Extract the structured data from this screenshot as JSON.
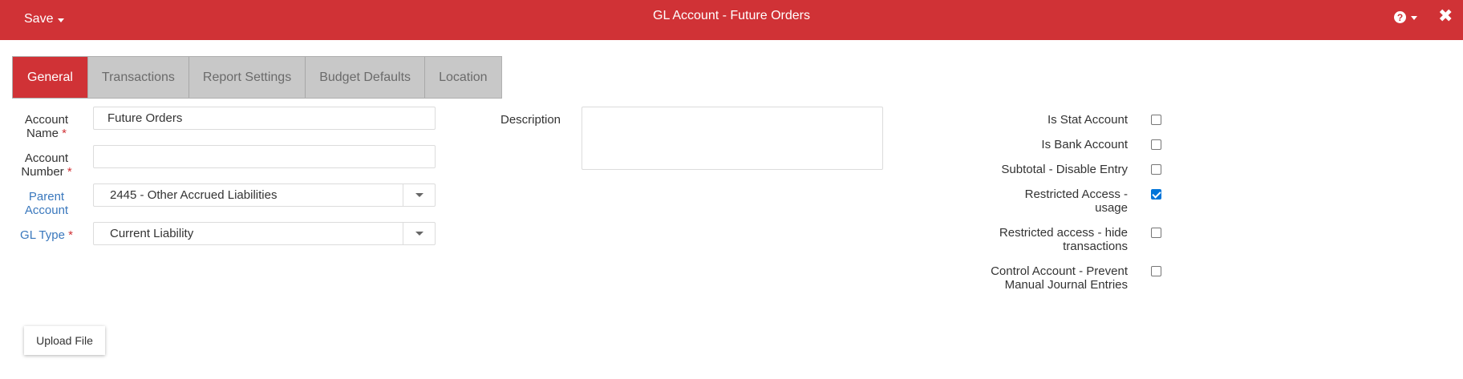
{
  "header": {
    "save_label": "Save",
    "title": "GL Account - Future Orders",
    "help_icon": "question-circle-icon",
    "close_icon": "close-icon",
    "close_glyph": "✖",
    "help_glyph": "?"
  },
  "tabs": [
    {
      "label": "General",
      "active": true
    },
    {
      "label": "Transactions",
      "active": false
    },
    {
      "label": "Report Settings",
      "active": false
    },
    {
      "label": "Budget Defaults",
      "active": false
    },
    {
      "label": "Location",
      "active": false
    }
  ],
  "form": {
    "account_name": {
      "label_line1": "Account",
      "label_line2": "Name",
      "required_mark": "*",
      "value": "Future Orders"
    },
    "account_number": {
      "label_line1": "Account",
      "label_line2": "Number",
      "required_mark": "*",
      "value": ""
    },
    "parent_account": {
      "label_line1": "Parent",
      "label_line2": "Account",
      "value": "2445 - Other Accrued Liabilities"
    },
    "gl_type": {
      "label": "GL Type",
      "required_mark": "*",
      "value": "Current Liability"
    },
    "description": {
      "label": "Description",
      "value": ""
    }
  },
  "checkboxes": [
    {
      "label_line1": "Is Stat Account",
      "label_line2": "",
      "checked": false
    },
    {
      "label_line1": "Is Bank Account",
      "label_line2": "",
      "checked": false
    },
    {
      "label_line1": "Subtotal - Disable Entry",
      "label_line2": "",
      "checked": false
    },
    {
      "label_line1": "Restricted Access -",
      "label_line2": "usage",
      "checked": true
    },
    {
      "label_line1": "Restricted access - hide",
      "label_line2": "transactions",
      "checked": false
    },
    {
      "label_line1": "Control Account - Prevent",
      "label_line2": "Manual Journal Entries",
      "checked": false
    }
  ],
  "footer": {
    "upload_label": "Upload File"
  },
  "colors": {
    "brand": "#d03236",
    "link": "#3a78bd",
    "checkbox_checked": "#0075d9"
  }
}
